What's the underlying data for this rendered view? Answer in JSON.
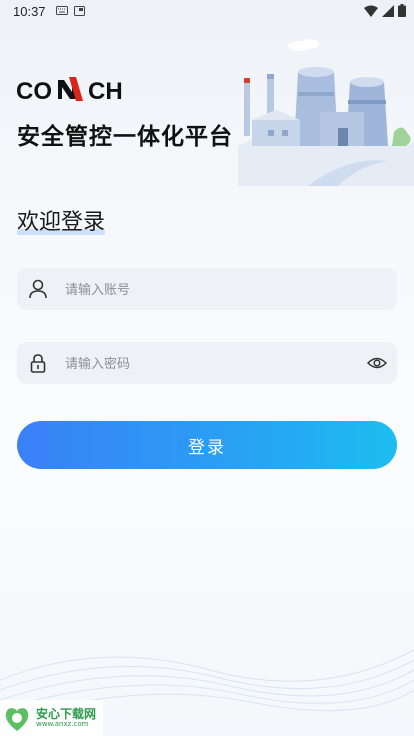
{
  "status_bar": {
    "time": "10:37",
    "left_icons": [
      "keyboard-icon",
      "screenshot-icon"
    ],
    "right_icons": [
      "wifi-icon",
      "signal-icon",
      "battery-icon"
    ]
  },
  "brand": {
    "logo_text": "CONCH",
    "accent_color": "#d9261c",
    "platform_title": "安全管控一体化平台"
  },
  "login": {
    "welcome": "欢迎登录",
    "account_placeholder": "请输入账号",
    "password_placeholder": "请输入密码",
    "submit_label": "登录",
    "button_gradient": [
      "#3a80f7",
      "#1dbdf0"
    ]
  },
  "watermark": {
    "text": "安心下载网",
    "url": "www.anxz.com"
  }
}
